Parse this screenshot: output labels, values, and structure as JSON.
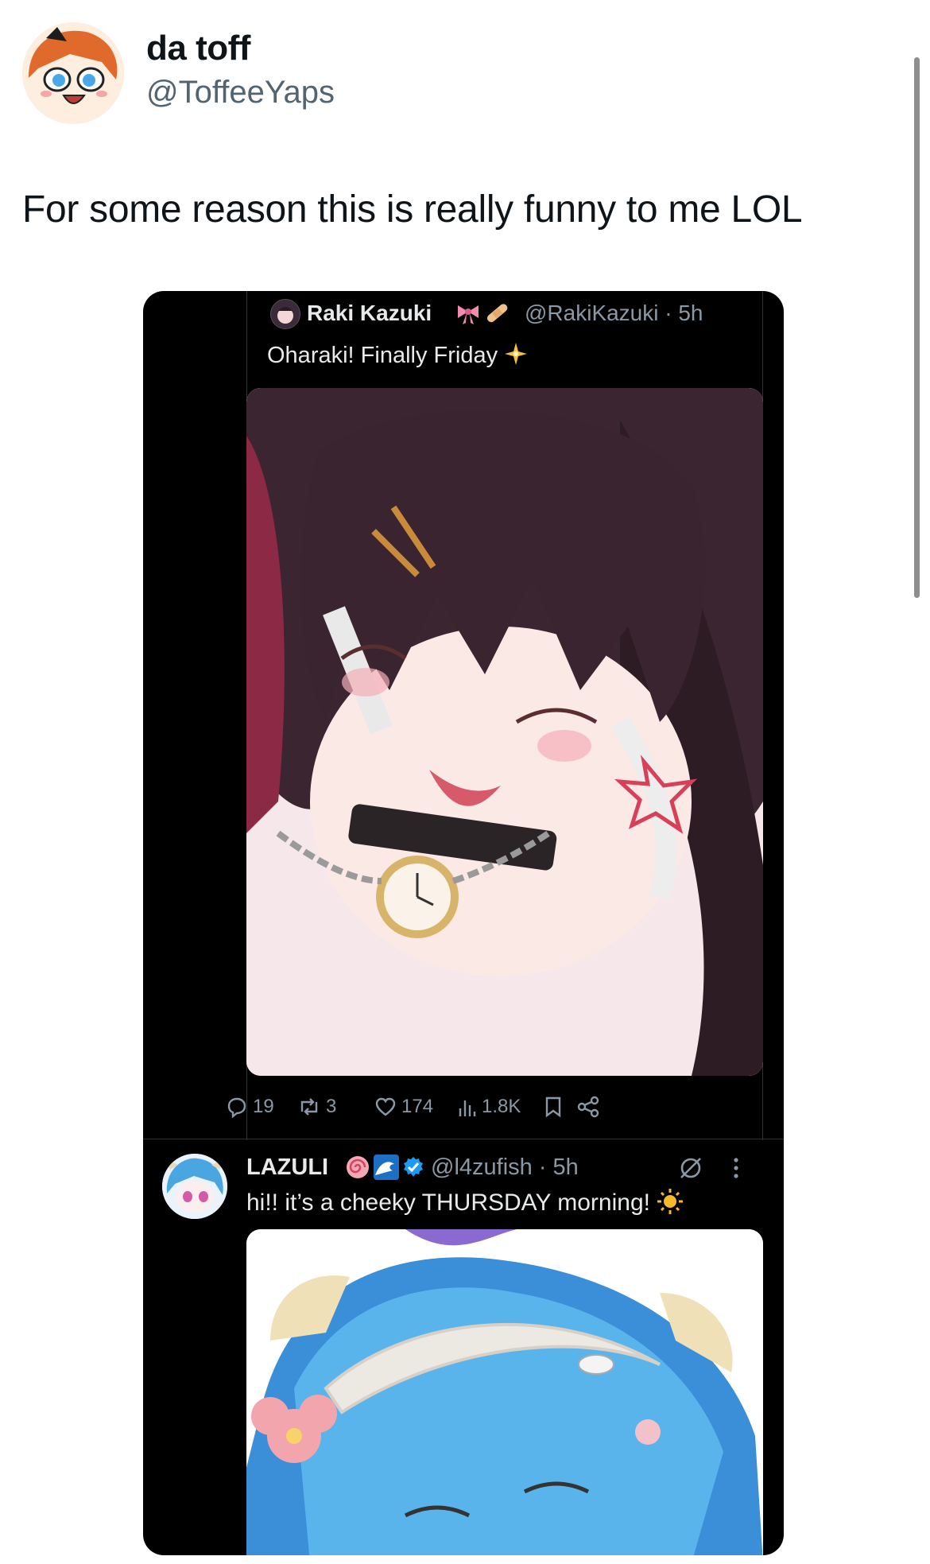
{
  "tweet": {
    "display_name": "da toff",
    "handle": "@ToffeeYaps",
    "text": "For some reason this is really funny to me LOL"
  },
  "embed": {
    "quoted": {
      "name": "Raki Kazuki",
      "name_emojis": [
        "ribbon-emoji",
        "bandage-emoji"
      ],
      "handle": "@RakiKazuki · 5h",
      "text": "Oharaki! Finally Friday",
      "text_emoji": "sparkle-emoji"
    },
    "actions": {
      "replies": "19",
      "reposts": "3",
      "likes": "174",
      "views": "1.8K"
    },
    "reply": {
      "name": "LAZULI",
      "name_emojis": [
        "spiral-emoji",
        "wave-emoji",
        "verified-badge"
      ],
      "handle": "@l4zufish · 5h",
      "text": "hi!! it’s a cheeky THURSDAY morning!",
      "text_emoji": "sun-emoji"
    }
  },
  "colors": {
    "text_primary": "#0f1419",
    "text_secondary": "#536471",
    "dark_bg": "#000000",
    "dark_text": "#e7e9ea",
    "dark_muted": "#8b98a5",
    "verified": "#1d9bf0"
  }
}
